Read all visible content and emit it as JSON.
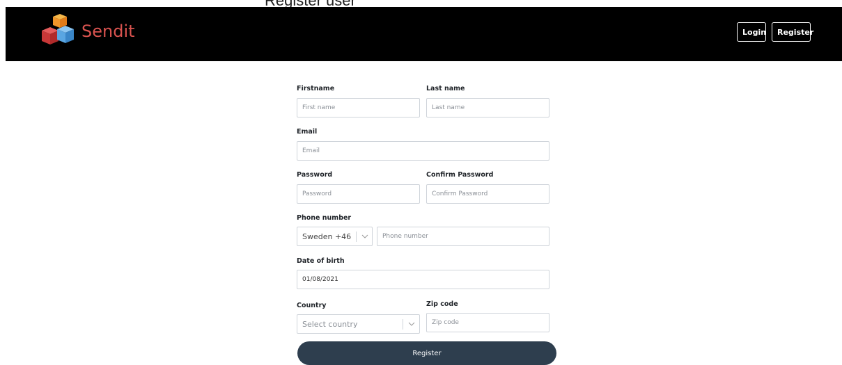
{
  "page": {
    "top_text": "Register user"
  },
  "navbar": {
    "brand": "Sendit",
    "login_label": "Login",
    "register_label": "Register"
  },
  "form": {
    "firstname": {
      "label": "Firstname",
      "placeholder": "First name",
      "value": ""
    },
    "lastname": {
      "label": "Last name",
      "placeholder": "Last name",
      "value": ""
    },
    "email": {
      "label": "Email",
      "placeholder": "Email",
      "value": ""
    },
    "password": {
      "label": "Password",
      "placeholder": "Password",
      "value": ""
    },
    "confirm_password": {
      "label": "Confirm Password",
      "placeholder": "Confirm Password",
      "value": ""
    },
    "phone": {
      "label": "Phone number",
      "country_code": "Sweden +46",
      "placeholder": "Phone number",
      "value": ""
    },
    "dob": {
      "label": "Date of birth",
      "value": "01/08/2021"
    },
    "country": {
      "label": "Country",
      "placeholder": "Select country"
    },
    "zip": {
      "label": "Zip code",
      "placeholder": "Zip code",
      "value": ""
    },
    "submit_label": "Register"
  },
  "colors": {
    "navbar_bg": "#000000",
    "brand": "#d9534f",
    "submit_bg": "#2e3e4e"
  },
  "icons": {
    "logo": "cubes-logo-icon",
    "dropdown": "chevron-down-icon"
  }
}
